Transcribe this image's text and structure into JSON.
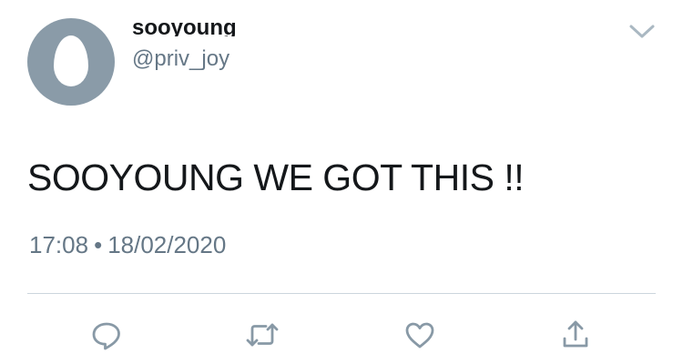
{
  "author": {
    "display_name": "sooyoung",
    "handle": "@priv_joy",
    "avatar_icon": "default-egg-avatar",
    "avatar_color": "#8a9ba8"
  },
  "tweet": {
    "text": "SOOYOUNG WE GOT THIS !!",
    "time": "17:08",
    "separator": "•",
    "date": "18/02/2020"
  },
  "actions": [
    {
      "icon": "reply-icon"
    },
    {
      "icon": "retweet-icon"
    },
    {
      "icon": "like-icon"
    },
    {
      "icon": "share-icon"
    }
  ],
  "menu": {
    "icon": "chevron-down-icon"
  },
  "colors": {
    "text": "#14171a",
    "secondary": "#657786",
    "icon": "#8899a6",
    "divider": "#ccd6dd"
  }
}
